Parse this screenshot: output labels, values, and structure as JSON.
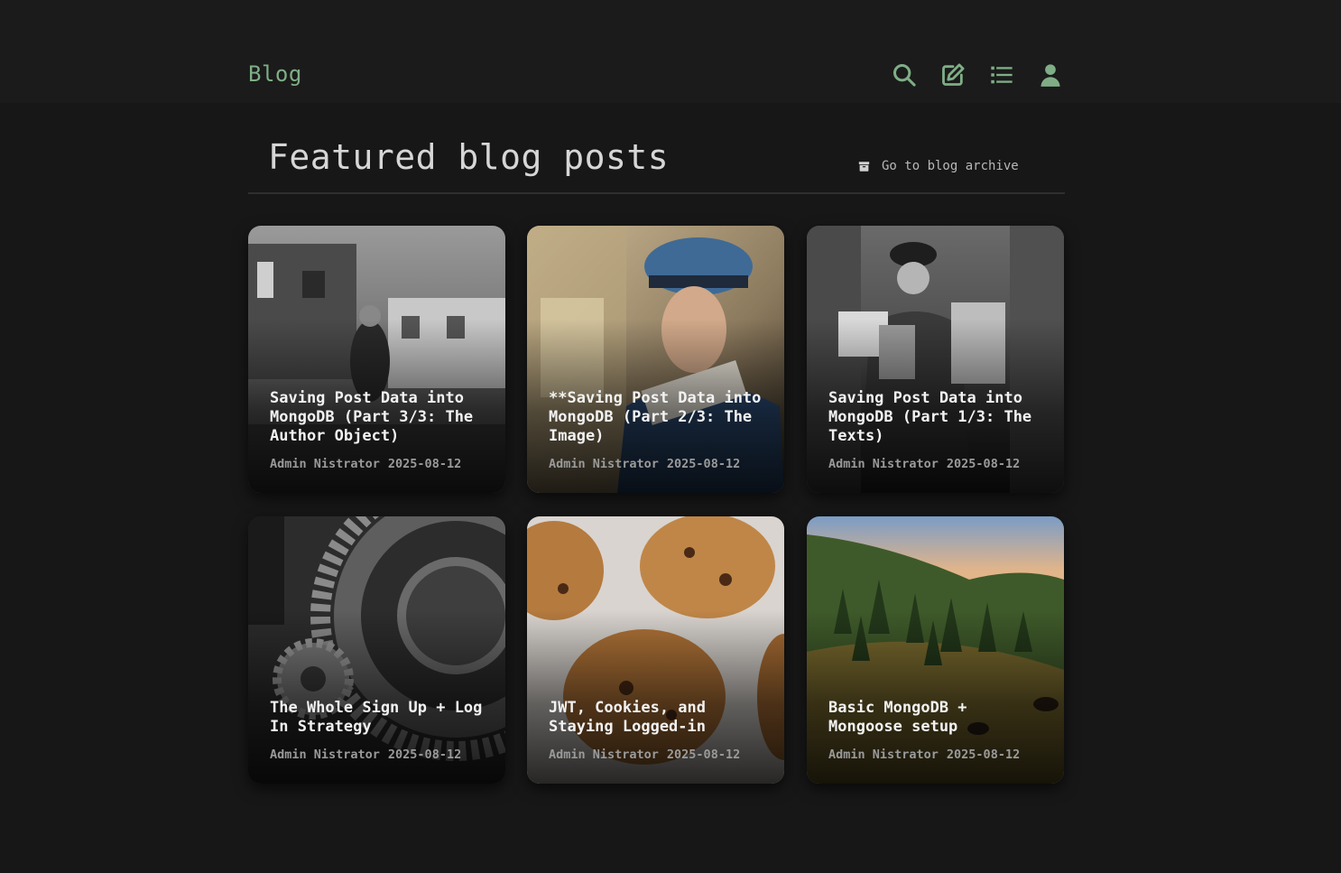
{
  "header": {
    "brand": "Blog",
    "nav_icons": [
      "search-icon",
      "edit-icon",
      "list-icon",
      "user-icon"
    ],
    "accent": "#7fae86"
  },
  "main": {
    "heading": "Featured blog posts",
    "archive_link": "Go to blog archive"
  },
  "posts": [
    {
      "title": "Saving Post Data into MongoDB (Part 3/3: The Author Object)",
      "author": "Admin Nistrator",
      "date": "2025-08-12"
    },
    {
      "title": "**Saving Post Data into MongoDB (Part 2/3: The Image)",
      "author": "Admin Nistrator",
      "date": "2025-08-12"
    },
    {
      "title": "Saving Post Data into MongoDB (Part 1/3: The Texts)",
      "author": "Admin Nistrator",
      "date": "2025-08-12"
    },
    {
      "title": "The Whole Sign Up + Log In Strategy",
      "author": "Admin Nistrator",
      "date": "2025-08-12"
    },
    {
      "title": "JWT, Cookies, and Staying Logged-in",
      "author": "Admin Nistrator",
      "date": "2025-08-12"
    },
    {
      "title": "Basic MongoDB + Mongoose setup",
      "author": "Admin Nistrator",
      "date": "2025-08-12"
    }
  ]
}
